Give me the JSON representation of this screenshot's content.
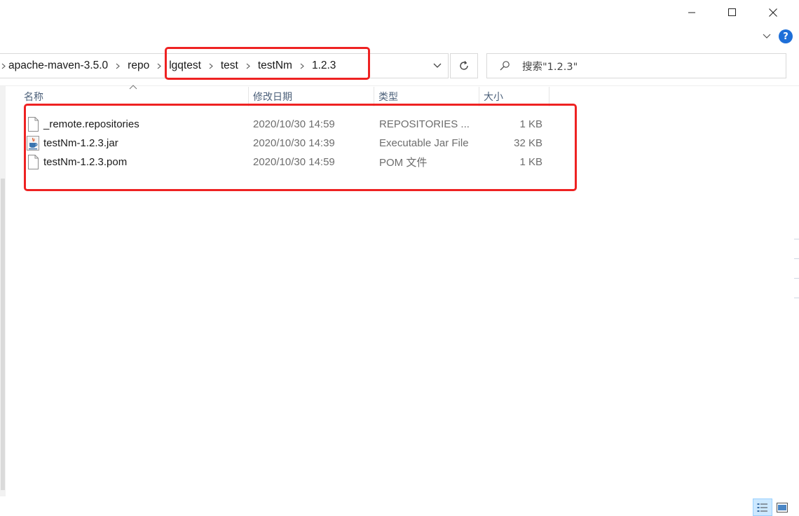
{
  "window": {
    "minimize_icon": "minimize-icon",
    "maximize_icon": "maximize-icon",
    "close_icon": "close-icon",
    "help_label": "?"
  },
  "address": {
    "path": [
      "apache-maven-3.5.0",
      "repo",
      "lgqtest",
      "test",
      "testNm",
      "1.2.3"
    ]
  },
  "search": {
    "placeholder": "搜索\"1.2.3\""
  },
  "columns": {
    "name": "名称",
    "date": "修改日期",
    "type": "类型",
    "size": "大小"
  },
  "files": [
    {
      "name": "_remote.repositories",
      "date": "2020/10/30 14:59",
      "type": "REPOSITORIES ...",
      "size": "1 KB",
      "icon": "file-icon"
    },
    {
      "name": "testNm-1.2.3.jar",
      "date": "2020/10/30 14:39",
      "type": "Executable Jar File",
      "size": "32 KB",
      "icon": "java-jar-icon"
    },
    {
      "name": "testNm-1.2.3.pom",
      "date": "2020/10/30 14:59",
      "type": "POM 文件",
      "size": "1 KB",
      "icon": "file-icon"
    }
  ],
  "colors": {
    "highlight": "#ee2222",
    "help": "#1e6fd8",
    "header_text": "#4c607a"
  }
}
